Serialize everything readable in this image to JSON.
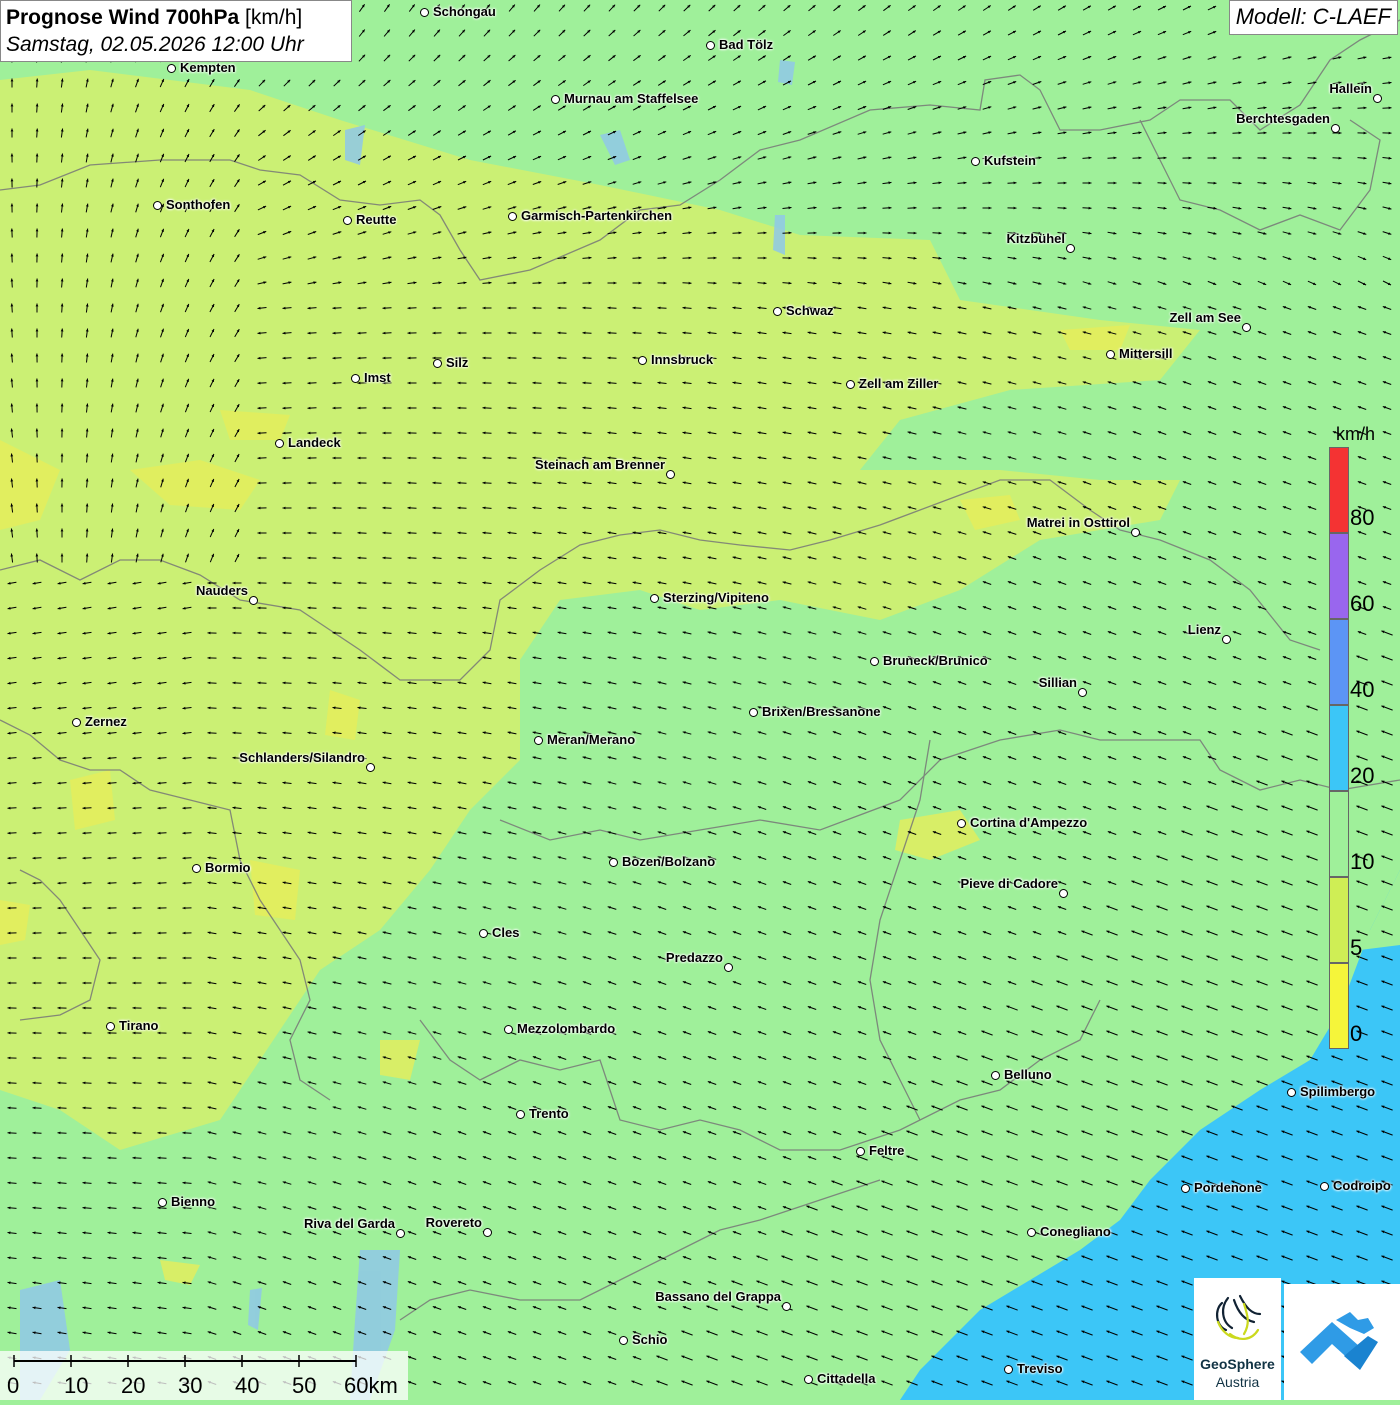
{
  "header": {
    "title_bold": "Prognose Wind 700hPa",
    "title_unit": " [km/h]",
    "datetime": "Samstag, 02.05.2026 12:00 Uhr",
    "model": "Modell: C-LAEF"
  },
  "legend": {
    "unit": "km/h",
    "labels": [
      "80",
      "60",
      "40",
      "20",
      "10",
      "5",
      "0"
    ],
    "colors": [
      "#f43333",
      "#9966ee",
      "#5c95f5",
      "#3cc6f7",
      "#9ff09a",
      "#cfee55",
      "#f5f53a"
    ]
  },
  "scalebar": {
    "labels": [
      "0",
      "10",
      "20",
      "30",
      "40",
      "50",
      "60km"
    ]
  },
  "cities": [
    {
      "name": "Schongau",
      "label_side": "right"
    },
    {
      "name": "Bad Tölz",
      "label_side": "right"
    },
    {
      "name": "Kempten",
      "label_side": "right"
    },
    {
      "name": "Murnau am Staffelsee",
      "label_side": "right"
    },
    {
      "name": "Hallein",
      "label_side": "left"
    },
    {
      "name": "Berchtesgaden",
      "label_side": "left"
    },
    {
      "name": "Kufstein",
      "label_side": "right"
    },
    {
      "name": "Sonthofen",
      "label_side": "right"
    },
    {
      "name": "Reutte",
      "label_side": "right"
    },
    {
      "name": "Garmisch-Partenkirchen",
      "label_side": "right"
    },
    {
      "name": "Kitzbühel",
      "label_side": "left"
    },
    {
      "name": "Schwaz",
      "label_side": "right"
    },
    {
      "name": "Zell am See",
      "label_side": "left"
    },
    {
      "name": "Mittersill",
      "label_side": "right"
    },
    {
      "name": "Innsbruck",
      "label_side": "right"
    },
    {
      "name": "Silz",
      "label_side": "right"
    },
    {
      "name": "Imst",
      "label_side": "right"
    },
    {
      "name": "Zell am Ziller",
      "label_side": "right"
    },
    {
      "name": "Landeck",
      "label_side": "right"
    },
    {
      "name": "Steinach am Brenner",
      "label_side": "left"
    },
    {
      "name": "Matrei in Osttirol",
      "label_side": "left"
    },
    {
      "name": "Nauders",
      "label_side": "left"
    },
    {
      "name": "Sterzing/Vipiteno",
      "label_side": "right"
    },
    {
      "name": "Lienz",
      "label_side": "left"
    },
    {
      "name": "Bruneck/Brunico",
      "label_side": "right"
    },
    {
      "name": "Sillian",
      "label_side": "left"
    },
    {
      "name": "Zernez",
      "label_side": "right"
    },
    {
      "name": "Brixen/Bressanone",
      "label_side": "right"
    },
    {
      "name": "Meran/Merano",
      "label_side": "right"
    },
    {
      "name": "Schlanders/Silandro",
      "label_side": "left"
    },
    {
      "name": "Cortina d'Ampezzo",
      "label_side": "right"
    },
    {
      "name": "Bozen/Bolzano",
      "label_side": "right"
    },
    {
      "name": "Bormio",
      "label_side": "right"
    },
    {
      "name": "Pieve di Cadore",
      "label_side": "left"
    },
    {
      "name": "Cles",
      "label_side": "right"
    },
    {
      "name": "Predazzo",
      "label_side": "left"
    },
    {
      "name": "Tirano",
      "label_side": "right"
    },
    {
      "name": "Mezzolombardo",
      "label_side": "right"
    },
    {
      "name": "Belluno",
      "label_side": "right"
    },
    {
      "name": "Spilimbergo",
      "label_side": "right"
    },
    {
      "name": "Trento",
      "label_side": "right"
    },
    {
      "name": "Feltre",
      "label_side": "right"
    },
    {
      "name": "Pordenone",
      "label_side": "right"
    },
    {
      "name": "Codroipo",
      "label_side": "right"
    },
    {
      "name": "Bienno",
      "label_side": "right"
    },
    {
      "name": "Riva del Garda",
      "label_side": "left"
    },
    {
      "name": "Rovereto",
      "label_side": "left"
    },
    {
      "name": "Conegliano",
      "label_side": "right"
    },
    {
      "name": "Bassano del Grappa",
      "label_side": "left"
    },
    {
      "name": "Schio",
      "label_side": "right"
    },
    {
      "name": "Treviso",
      "label_side": "right"
    },
    {
      "name": "Cittadella",
      "label_side": "right"
    }
  ],
  "logos": {
    "geosphere_name": "GeoSphere",
    "geosphere_sub": "Austria"
  }
}
